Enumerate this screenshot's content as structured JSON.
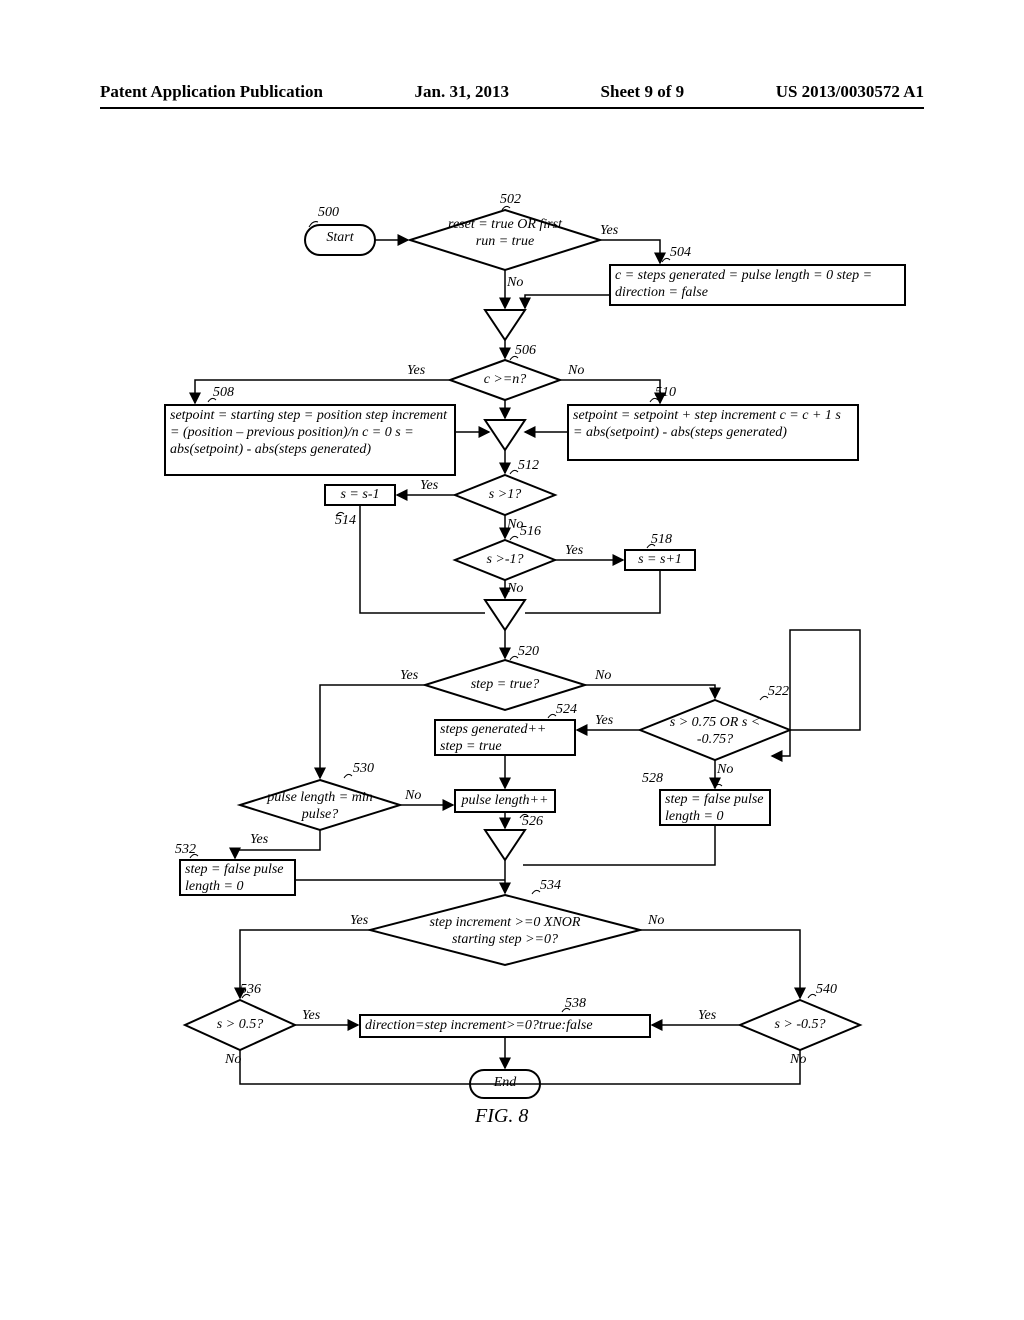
{
  "header": {
    "pub": "Patent Application Publication",
    "date": "Jan. 31, 2013",
    "sheet": "Sheet 9 of 9",
    "num": "US 2013/0030572 A1"
  },
  "figure": "FIG. 8",
  "labels": {
    "start": "Start",
    "end": "End",
    "yes": "Yes",
    "no": "No"
  },
  "nodes": {
    "n502": "reset = true\nOR\nfirst run = true",
    "n504": "c = steps generated = pulse length = 0\nstep = direction = false",
    "n506": "c >=n?",
    "n508": "setpoint = starting step = position\nstep increment = (position – previous position)/n\nc = 0\ns = abs(setpoint) - abs(steps generated)",
    "n510": "setpoint = setpoint + step increment\nc = c + 1\ns = abs(setpoint) - abs(steps generated)",
    "n512": "s >1?",
    "n514": "s = s-1",
    "n516": "s >-1?",
    "n518": "s = s+1",
    "n520": "step = true?",
    "n522": "s > 0.75 OR\ns < -0.75?",
    "n524": "steps generated++\nstep = true",
    "n526": "pulse length++",
    "n528": "step = false\npulse length = 0",
    "n530": "pulse length\n= min pulse?",
    "n532": "step = false\npulse length = 0",
    "n534": "step increment >=0\nXNOR starting step >=0?",
    "n536": "s > 0.5?",
    "n538": "direction=step increment>=0?true:false",
    "n540": "s > -0.5?"
  },
  "refs": {
    "r500": "500",
    "r502": "502",
    "r504": "504",
    "r506": "506",
    "r508": "508",
    "r510": "510",
    "r512": "512",
    "r514": "514",
    "r516": "516",
    "r518": "518",
    "r520": "520",
    "r522": "522",
    "r524": "524",
    "r526": "526",
    "r528": "528",
    "r530": "530",
    "r532": "532",
    "r534": "534",
    "r536": "536",
    "r538": "538",
    "r540": "540"
  }
}
